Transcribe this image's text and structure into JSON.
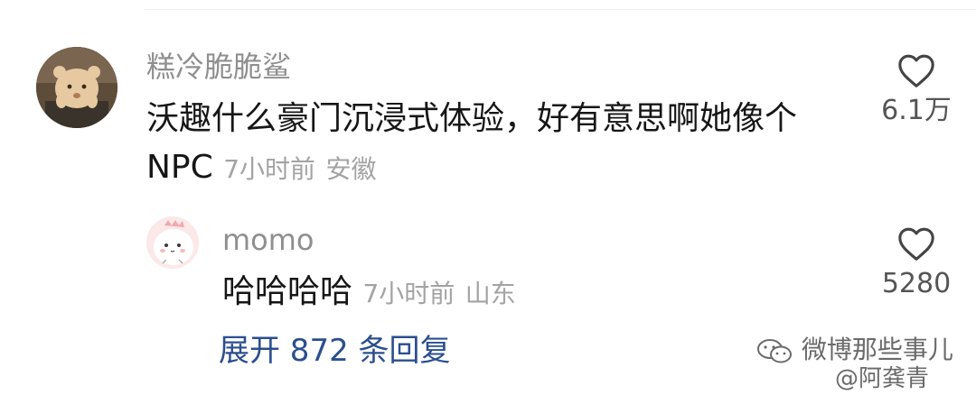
{
  "comment": {
    "username": "糕冷脆脆鲨",
    "text_line1": "沃趣什么豪门沉浸式体验，好有意思啊她像个",
    "text_line2": "NPC",
    "time": "7小时前",
    "location": "安徽",
    "likes": "6.1万",
    "avatar": "cat-avatar-icon"
  },
  "reply": {
    "username": "momo",
    "text": "哈哈哈哈",
    "time": "7小时前",
    "location": "山东",
    "likes": "5280",
    "avatar": "pink-dino-avatar-icon"
  },
  "expand": {
    "label": "展开 872 条回复"
  },
  "watermark": {
    "line1": "微博那些事儿",
    "line2": "@阿龚青"
  },
  "colors": {
    "username": "#8f8f8f",
    "text": "#161616",
    "meta": "#a3a3a3",
    "link": "#2b4f8e"
  }
}
